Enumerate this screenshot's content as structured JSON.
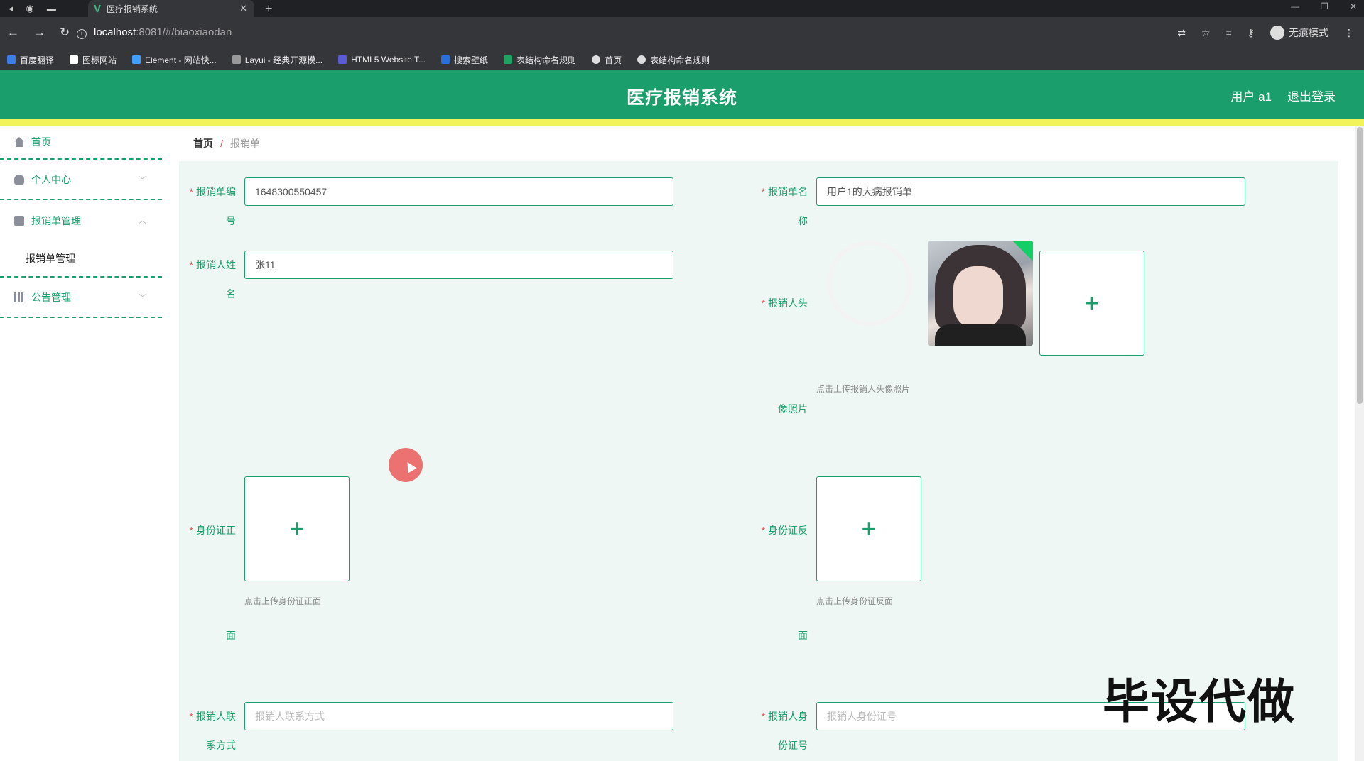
{
  "browser": {
    "tab_title": "医疗报销系统",
    "url_host": "localhost",
    "url_path": ":8081/#/biaoxiaodan",
    "incognito_label": "无痕模式",
    "bookmarks": [
      "百度翻译",
      "图标网站",
      "Element - 网站快...",
      "Layui - 经典开源模...",
      "HTML5 Website T...",
      "搜索壁纸",
      "表结构命名规则",
      "首页",
      "表结构命名规则"
    ]
  },
  "header": {
    "title": "医疗报销系统",
    "user": "用户 a1",
    "logout": "退出登录"
  },
  "sidebar": {
    "items": [
      {
        "label": "首页"
      },
      {
        "label": "个人中心"
      },
      {
        "label": "报销单管理"
      },
      {
        "label": "报销单管理"
      },
      {
        "label": "公告管理"
      }
    ]
  },
  "breadcrumb": {
    "home": "首页",
    "sep": "/",
    "current": "报销单"
  },
  "form": {
    "number_label_a": "报销单编",
    "number_label_b": "号",
    "number_value": "1648300550457",
    "name_label_a": "报销单名",
    "name_label_b": "称",
    "name_value": "用户1的大病报销单",
    "person_label_a": "报销人姓",
    "person_label_b": "名",
    "person_value": "张11",
    "avatar_label_a": "报销人头",
    "avatar_label_b": "像照片",
    "avatar_hint": "点击上传报销人头像照片",
    "id_front_label_a": "身份证正",
    "id_front_label_b": "面",
    "id_front_hint": "点击上传身份证正面",
    "id_back_label_a": "身份证反",
    "id_back_label_b": "面",
    "id_back_hint": "点击上传身份证反面",
    "contact_label_a": "报销人联",
    "contact_label_b": "系方式",
    "contact_placeholder": "报销人联系方式",
    "idno_label_a": "报销人身",
    "idno_label_b": "份证号",
    "idno_placeholder": "报销人身份证号"
  },
  "watermark": "毕设代做"
}
